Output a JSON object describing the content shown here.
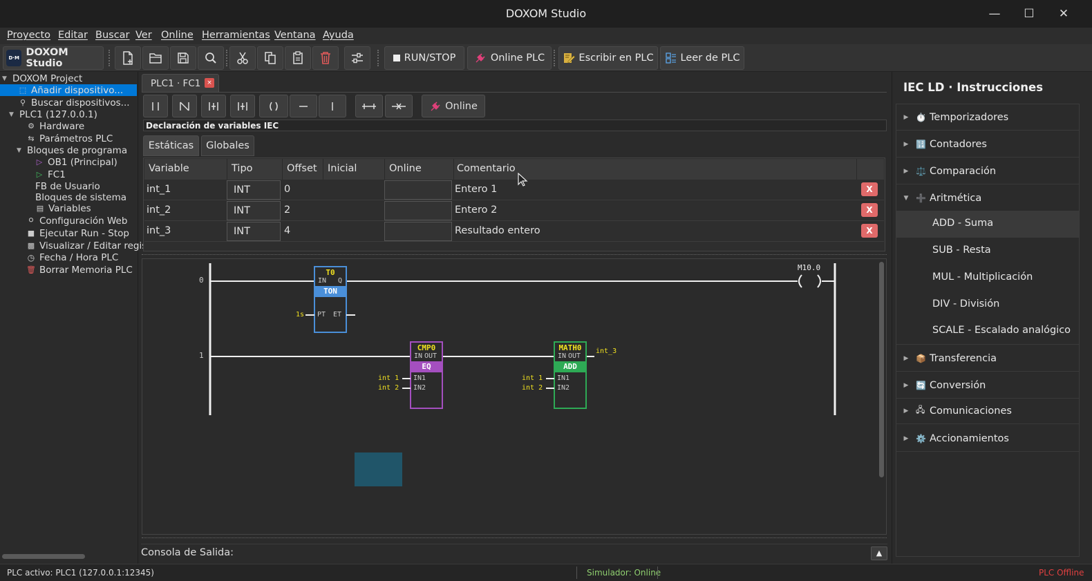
{
  "window": {
    "title": "DOXOM Studio"
  },
  "menu": [
    "Proyecto",
    "Editar",
    "Buscar",
    "Ver",
    "Online",
    "Herramientas",
    "Ventana",
    "Ayuda"
  ],
  "toolbar": {
    "brand": "DOXOM Studio",
    "brand_logo": "D·M",
    "run_stop": "RUN/STOP",
    "online_plc": "Online PLC",
    "write_plc": "Escribir en PLC",
    "read_plc": "Leer de PLC"
  },
  "tree": {
    "project": "DOXOM Project",
    "add_device": "Añadir dispositivo...",
    "search_devices": "Buscar dispositivos...",
    "plc": "PLC1 (127.0.0.1)",
    "hardware": "Hardware",
    "plc_params": "Parámetros PLC",
    "blocks": "Bloques de programa",
    "ob1": "OB1 (Principal)",
    "fc1": "FC1",
    "user_fb": "FB de Usuario",
    "system_blocks": "Bloques de sistema",
    "variables": "Variables",
    "web_config": "Configuración Web",
    "run_stop": "Ejecutar Run - Stop",
    "view_edit": "Visualizar / Editar regis",
    "date_time": "Fecha / Hora PLC",
    "erase_mem": "Borrar Memoria PLC"
  },
  "editor": {
    "tab": "PLC1 · FC1",
    "tab_close": "×",
    "online_btn": "Online",
    "decl_title": "Declaración de variables IEC",
    "subtabs": [
      "Estáticas",
      "Globales"
    ],
    "columns": [
      "Variable",
      "Tipo",
      "Offset",
      "Inicial",
      "Online",
      "Comentario"
    ],
    "rows": [
      {
        "variable": "int_1",
        "tipo": "INT",
        "offset": "0",
        "comentario": "Entero 1"
      },
      {
        "variable": "int_2",
        "tipo": "INT",
        "offset": "2",
        "comentario": "Entero 2"
      },
      {
        "variable": "int_3",
        "tipo": "INT",
        "offset": "4",
        "comentario": "Resultado entero"
      }
    ],
    "delete_label": "X"
  },
  "ladder": {
    "rung0": "0",
    "rung1": "1",
    "timer": {
      "name": "T0",
      "in": "IN",
      "q": "Q",
      "type": "TON",
      "pt": "PT",
      "et": "ET",
      "pt_value": "1s"
    },
    "coil": {
      "name": "M10.0"
    },
    "cmp": {
      "name": "CMP0",
      "in": "IN",
      "out": "OUT",
      "type": "EQ",
      "in1": "IN1",
      "in2": "IN2",
      "in1_var": "int 1",
      "in2_var": "int 2"
    },
    "math": {
      "name": "MATH0",
      "in": "IN",
      "out": "OUT",
      "type": "ADD",
      "in1": "IN1",
      "in2": "IN2",
      "in1_var": "int 1",
      "in2_var": "int 2",
      "out_var": "int_3"
    }
  },
  "console": {
    "label": "Consola de Salida:",
    "toggle": "▲"
  },
  "instructions": {
    "title": "IEC LD · Instrucciones",
    "categories": [
      {
        "icon": "⏱️",
        "label": "Temporizadores"
      },
      {
        "icon": "🔢",
        "label": "Contadores"
      },
      {
        "icon": "⚖️",
        "label": "Comparación"
      },
      {
        "icon": "➕",
        "label": "Aritmética"
      },
      {
        "icon": "📦",
        "label": "Transferencia"
      },
      {
        "icon": "🔄",
        "label": "Conversión"
      },
      {
        "icon": "🖧",
        "label": "Comunicaciones"
      },
      {
        "icon": "⚙️",
        "label": "Accionamientos"
      }
    ],
    "arith_items": [
      "ADD - Suma",
      "SUB - Resta",
      "MUL - Multiplicación",
      "DIV - División",
      "SCALE - Escalado analógico"
    ]
  },
  "status": {
    "active_plc": "PLC activo: PLC1  (127.0.0.1:12345)",
    "simulator": "Simulador: Online",
    "plc_state": "PLC Offline"
  },
  "colors": {
    "accent": "#0078d7",
    "timer_block": "#4a8fd9",
    "cmp_block": "#a44fbf",
    "math_block": "#2eaa55",
    "ladder_label": "#f0e020",
    "offline": "#e04040",
    "online": "#8fcf6f"
  }
}
